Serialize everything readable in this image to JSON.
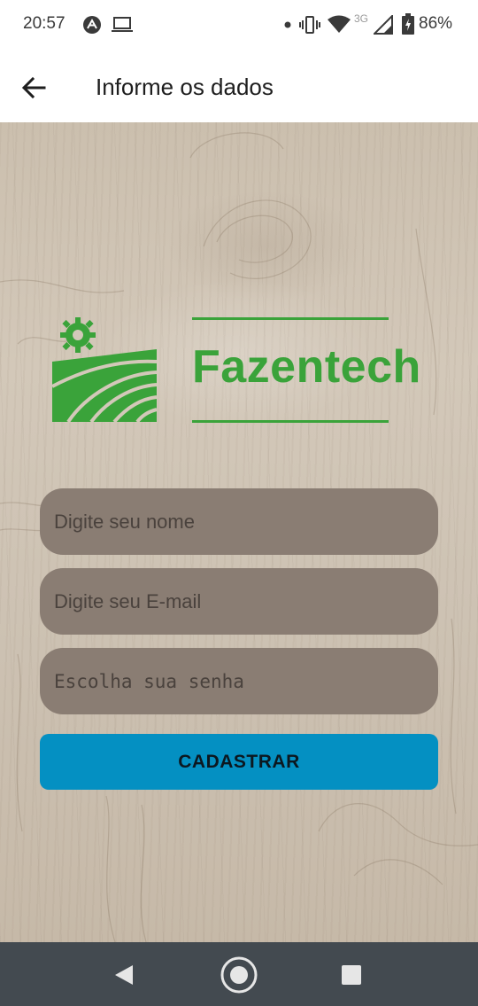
{
  "status_bar": {
    "time": "20:57",
    "network": "3G",
    "battery": "86%",
    "icons": [
      "assistant-icon",
      "laptop-icon",
      "dot-icon",
      "vibrate-icon",
      "wifi-icon",
      "signal-icon",
      "battery-icon"
    ]
  },
  "app_bar": {
    "title": "Informe os dados",
    "back_icon": "arrow-left-icon"
  },
  "logo": {
    "text": "Fazentech",
    "icon": "farm-field-gear-icon",
    "color": "#3aa33a"
  },
  "form": {
    "name_placeholder": "Digite seu nome",
    "email_placeholder": "Digite seu E-mail",
    "password_placeholder": "Escolha sua senha",
    "field_color": "#8a7d73",
    "submit_label": "CADASTRAR",
    "submit_color": "#0490c2"
  },
  "nav_bar": {
    "back": "triangle-back-icon",
    "home": "circle-home-icon",
    "recents": "square-recents-icon"
  }
}
